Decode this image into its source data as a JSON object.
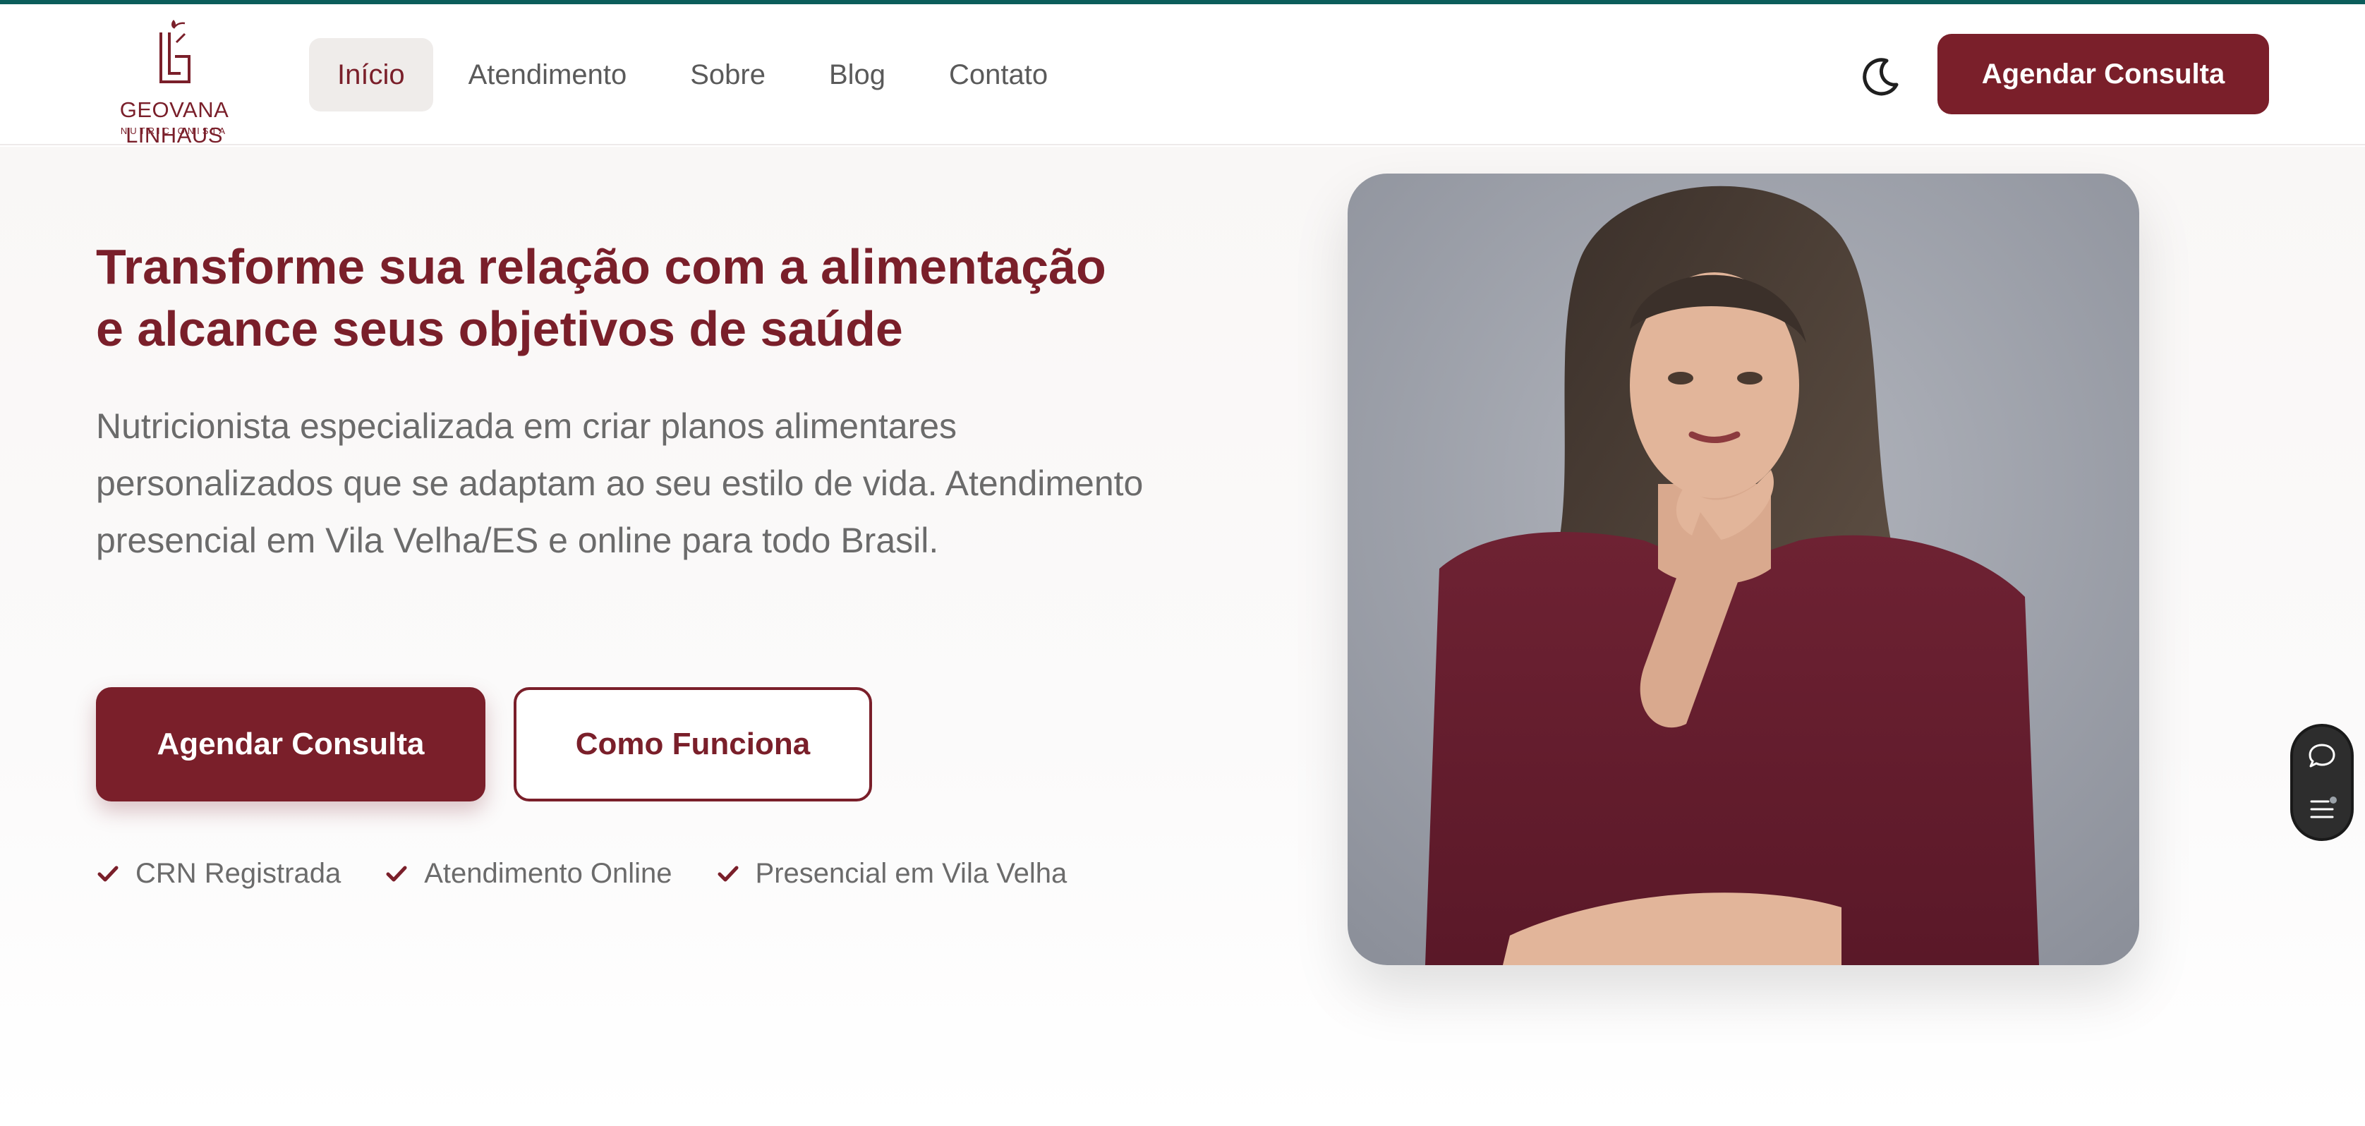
{
  "brand": {
    "name": "GEOVANA LINHAUS",
    "subtitle": "NUTRICIONISTA",
    "accent_color": "#7a1f2a",
    "topline_color": "#0b5d5b"
  },
  "nav": {
    "items": [
      {
        "label": "Início",
        "active": true
      },
      {
        "label": "Atendimento",
        "active": false
      },
      {
        "label": "Sobre",
        "active": false
      },
      {
        "label": "Blog",
        "active": false
      },
      {
        "label": "Contato",
        "active": false
      }
    ],
    "theme_toggle_icon": "moon-icon",
    "cta_label": "Agendar Consulta"
  },
  "hero": {
    "headline_line1": "Transforme sua relação com a alimentação",
    "headline_line2": "e alcance seus objetivos de saúde",
    "description": "Nutricionista especializada em criar planos alimentares personalizados que se adaptam ao seu estilo de vida. Atendimento presencial em Vila Velha/ES e online para todo Brasil.",
    "primary_button": "Agendar Consulta",
    "secondary_button": "Como Funciona",
    "features": [
      {
        "label": "CRN Registrada",
        "icon": "check-icon"
      },
      {
        "label": "Atendimento Online",
        "icon": "check-icon"
      },
      {
        "label": "Presencial em Vila Velha",
        "icon": "check-icon"
      }
    ]
  },
  "side_widget": {
    "icons": [
      "chat-icon",
      "menu-list-icon"
    ]
  }
}
